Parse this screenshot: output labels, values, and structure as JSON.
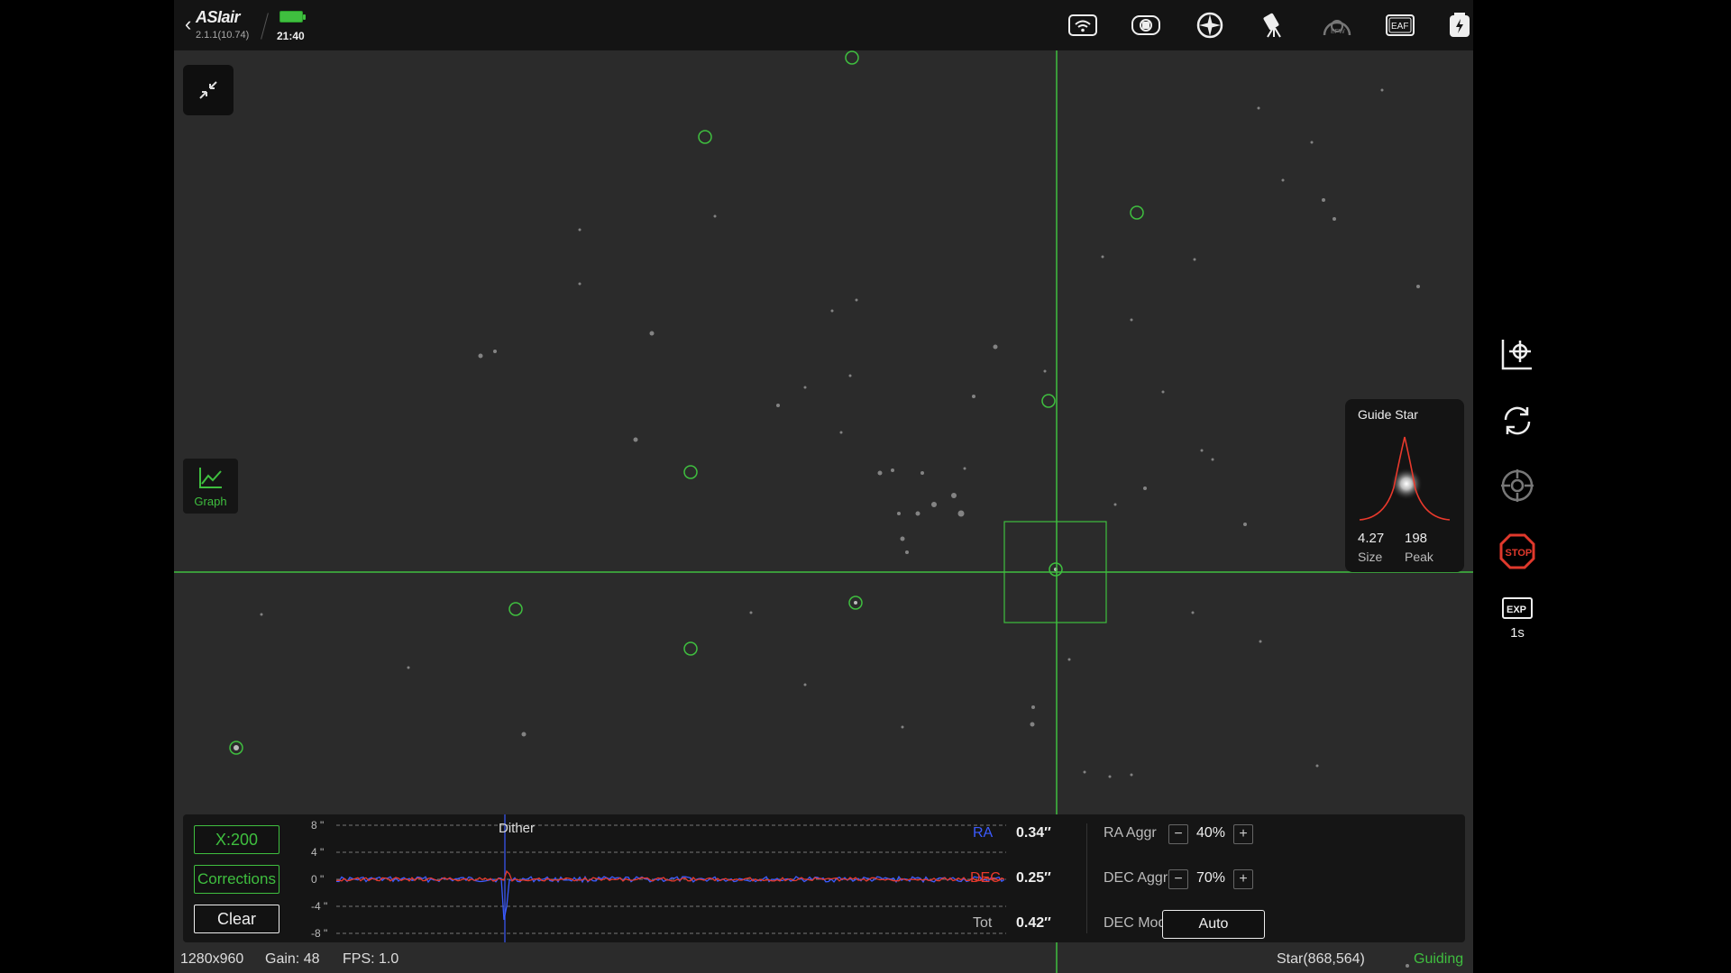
{
  "app": {
    "logo": "ASIair",
    "version": "2.1.1(10.74)",
    "time": "21:40"
  },
  "topbar_icons": [
    "wifi-icon",
    "camera-icon",
    "guide-scope-icon",
    "telescope-mount-icon",
    "filter-wheel-icon",
    "eaf-focuser-icon",
    "power-icon",
    "info-icon"
  ],
  "colors": {
    "accent": "#3fbf3f",
    "ra": "#3b5bff",
    "dec": "#e8392c",
    "stop": "#e0392c",
    "sky": "#2b2b2b"
  },
  "graph_toggle": {
    "label": "Graph"
  },
  "guide_star": {
    "title": "Guide Star",
    "size_value": "4.27",
    "size_label": "Size",
    "peak_value": "198",
    "peak_label": "Peak"
  },
  "guide_graph": {
    "scale_button": "X:200",
    "corrections_button": "Corrections",
    "clear_button": "Clear",
    "y_ticks": [
      "8 \"",
      "4 \"",
      "0 \"",
      "-4 \"",
      "-8 \""
    ],
    "dither_label": "Dither",
    "ra_label": "RA",
    "ra_value": "0.34″",
    "dec_label": "DEC",
    "dec_value": "0.25″",
    "tot_label": "Tot",
    "tot_value": "0.42″",
    "ra_aggr_label": "RA Aggr",
    "ra_aggr_value": "40%",
    "dec_aggr_label": "DEC Aggr",
    "dec_aggr_value": "70%",
    "dec_mode_label": "DEC Mode",
    "dec_mode_value": "Auto",
    "minus": "−",
    "plus": "+"
  },
  "status": {
    "resolution": "1280x960",
    "gain": "Gain: 48",
    "fps": "FPS: 1.0",
    "star": "Star(868,564)",
    "state": "Guiding"
  },
  "right_bar": {
    "exposure_value": "1s",
    "exp_icon_text": "EXP",
    "stop_icon_text": "STOP"
  }
}
